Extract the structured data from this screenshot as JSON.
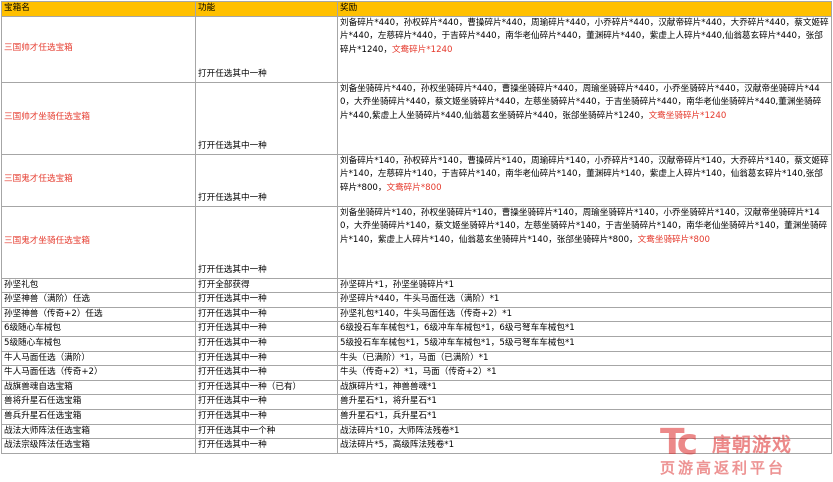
{
  "headers": {
    "name": "宝箱名",
    "function": "功能",
    "reward": "奖励"
  },
  "rows": [
    {
      "name": "三国帅才任选宝箱",
      "func": "打开任选其中一种",
      "reward": "刘备碎片*440，孙权碎片*440，曹操碎片*440，周瑜碎片*440，小乔碎片*440，汉献帝碎片*440，大乔碎片*440，蔡文姬碎片*440，左慈碎片*440，于吉碎片*440，南华老仙碎片*440，董渊碎片*440，紫虚上人碎片*440,仙翁葛玄碎片*440，张郃碎片*1240，",
      "hl": "文鸯碎片*1240"
    },
    {
      "name": "三国帅才坐骑任选宝箱",
      "func": "打开任选其中一种",
      "reward": "刘备坐骑碎片*440，孙权坐骑碎片*440，曹操坐骑碎片*440，周瑜坐骑碎片*440，小乔坐骑碎片*440，汉献帝坐骑碎片*440，大乔坐骑碎片*440，蔡文姬坐骑碎片*440，左慈坐骑碎片*440，于吉坐骑碎片*440，南华老仙坐骑碎片*440,董渊坐骑碎片*440,紫虚上人坐骑碎片*440,仙翁葛玄坐骑碎片*440，张郃坐骑碎片*1240，",
      "hl": "文鸯坐骑碎片*1240"
    },
    {
      "name": "三国鬼才任选宝箱",
      "func": "打开任选其中一种",
      "reward": "刘备碎片*140，孙权碎片*140，曹操碎片*140，周瑜碎片*140，小乔碎片*140，汉献帝碎片*140，大乔碎片*140，蔡文姬碎片*140，左慈碎片*140，于吉碎片*140，南华老仙碎片*140，董渊碎片*140，紫虚上人碎片*140，仙翁葛玄碎片*140,张郃碎片*800，",
      "hl": "文鸯碎片*800"
    },
    {
      "name": "三国鬼才坐骑任选宝箱",
      "func": "打开任选其中一种",
      "reward": "刘备坐骑碎片*140，孙权坐骑碎片*140，曹操坐骑碎片*140，周瑜坐骑碎片*140，小乔坐骑碎片*140，汉献帝坐骑碎片*140，大乔坐骑碎片*140，蔡文姬坐骑碎片*140，左慈坐骑碎片*140，于吉坐骑碎片*140，南华老仙坐骑碎片*140，董渊坐骑碎片*140，紫虚上人碎片*140，仙翁葛玄坐骑碎片*140，张郃坐骑碎片*800，",
      "hl": "文鸯坐骑碎片*800"
    },
    {
      "name": "孙坚礼包",
      "func": "打开全部获得",
      "reward": "孙坚碎片*1，孙坚坐骑碎片*1",
      "hl": ""
    },
    {
      "name": "孙坚神兽（满阶）任选",
      "func": "打开任选其中一种",
      "reward": "孙坚碎片*440，牛头马面任选（满阶）*1",
      "hl": ""
    },
    {
      "name": "孙坚神兽（传奇+2）任选",
      "func": "打开任选其中一种",
      "reward": "孙坚礼包*140，牛头马面任选（传奇+2）*1",
      "hl": ""
    },
    {
      "name": "6级随心车械包",
      "func": "打开任选其中一种",
      "reward": "6级投石车车械包*1，6级冲车车械包*1，6级弓弩车车械包*1",
      "hl": ""
    },
    {
      "name": "5级随心车械包",
      "func": "打开任选其中一种",
      "reward": "5级投石车车械包*1，5级冲车车械包*1，5级弓弩车车械包*1",
      "hl": ""
    },
    {
      "name": "牛人马面任选（满阶）",
      "func": "打开任选其中一种",
      "reward": "牛头（已满阶）*1，马面（已满阶）*1",
      "hl": ""
    },
    {
      "name": "牛人马面任选（传奇+2）",
      "func": "打开任选其中一种",
      "reward": "牛头（传奇+2）*1，马面（传奇+2）*1",
      "hl": ""
    },
    {
      "name": "战旗兽魂自选宝箱",
      "func": "打开任选其中一种（已有）",
      "reward": "战旗碎片*1，神兽兽魂*1",
      "hl": ""
    },
    {
      "name": "兽将升星石任选宝箱",
      "func": "打开任选其中一种",
      "reward": "兽升星石*1，将升星石*1",
      "hl": ""
    },
    {
      "name": "兽兵升星石任选宝箱",
      "func": "打开任选其中一种",
      "reward": "兽升星石*1，兵升星石*1",
      "hl": ""
    },
    {
      "name": "战法大师阵法任选宝箱",
      "func": "打开任选其中一个种",
      "reward": "战法碎片*10，大师阵法残卷*1",
      "hl": ""
    },
    {
      "name": "战法宗级阵法任选宝箱",
      "func": "打开任选其中一种",
      "reward": "战法碎片*5，高级阵法残卷*1",
      "hl": ""
    }
  ],
  "watermark": {
    "logo": "Tc",
    "name": "唐朝游戏",
    "slogan": "页游高返利平台"
  },
  "colors": {
    "header_bg": "#ffc000",
    "highlight": "#e53a2d",
    "border": "#a6a6a6"
  }
}
